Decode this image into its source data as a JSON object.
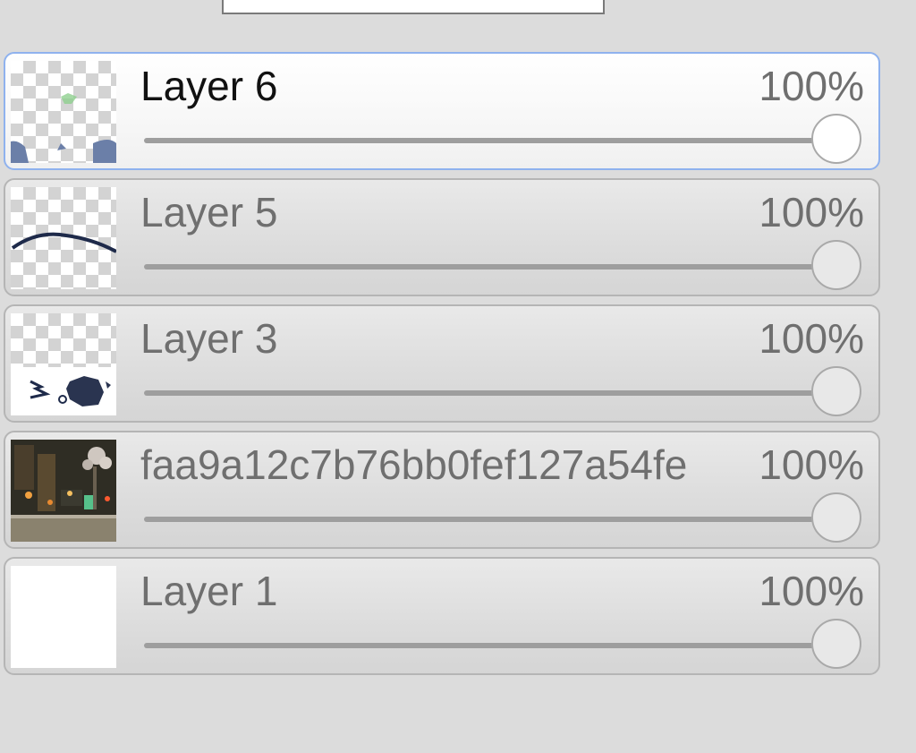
{
  "panel": {
    "layers": [
      {
        "name": "Layer 6",
        "opacity": "100%",
        "opacity_value": 1.0,
        "selected": true,
        "thumbnail": "layer-6-thumbnail"
      },
      {
        "name": "Layer 5",
        "opacity": "100%",
        "opacity_value": 1.0,
        "selected": false,
        "thumbnail": "layer-5-thumbnail"
      },
      {
        "name": "Layer 3",
        "opacity": "100%",
        "opacity_value": 1.0,
        "selected": false,
        "thumbnail": "layer-3-thumbnail"
      },
      {
        "name": "faa9a12c7b76bb0fef127a54fe",
        "opacity": "100%",
        "opacity_value": 1.0,
        "selected": false,
        "thumbnail": "photo-thumbnail"
      },
      {
        "name": "Layer 1",
        "opacity": "100%",
        "opacity_value": 1.0,
        "selected": false,
        "thumbnail": "white-thumbnail"
      }
    ]
  },
  "colors": {
    "selected_border": "#8fb2ee",
    "panel_background": "#dcdcdc"
  }
}
